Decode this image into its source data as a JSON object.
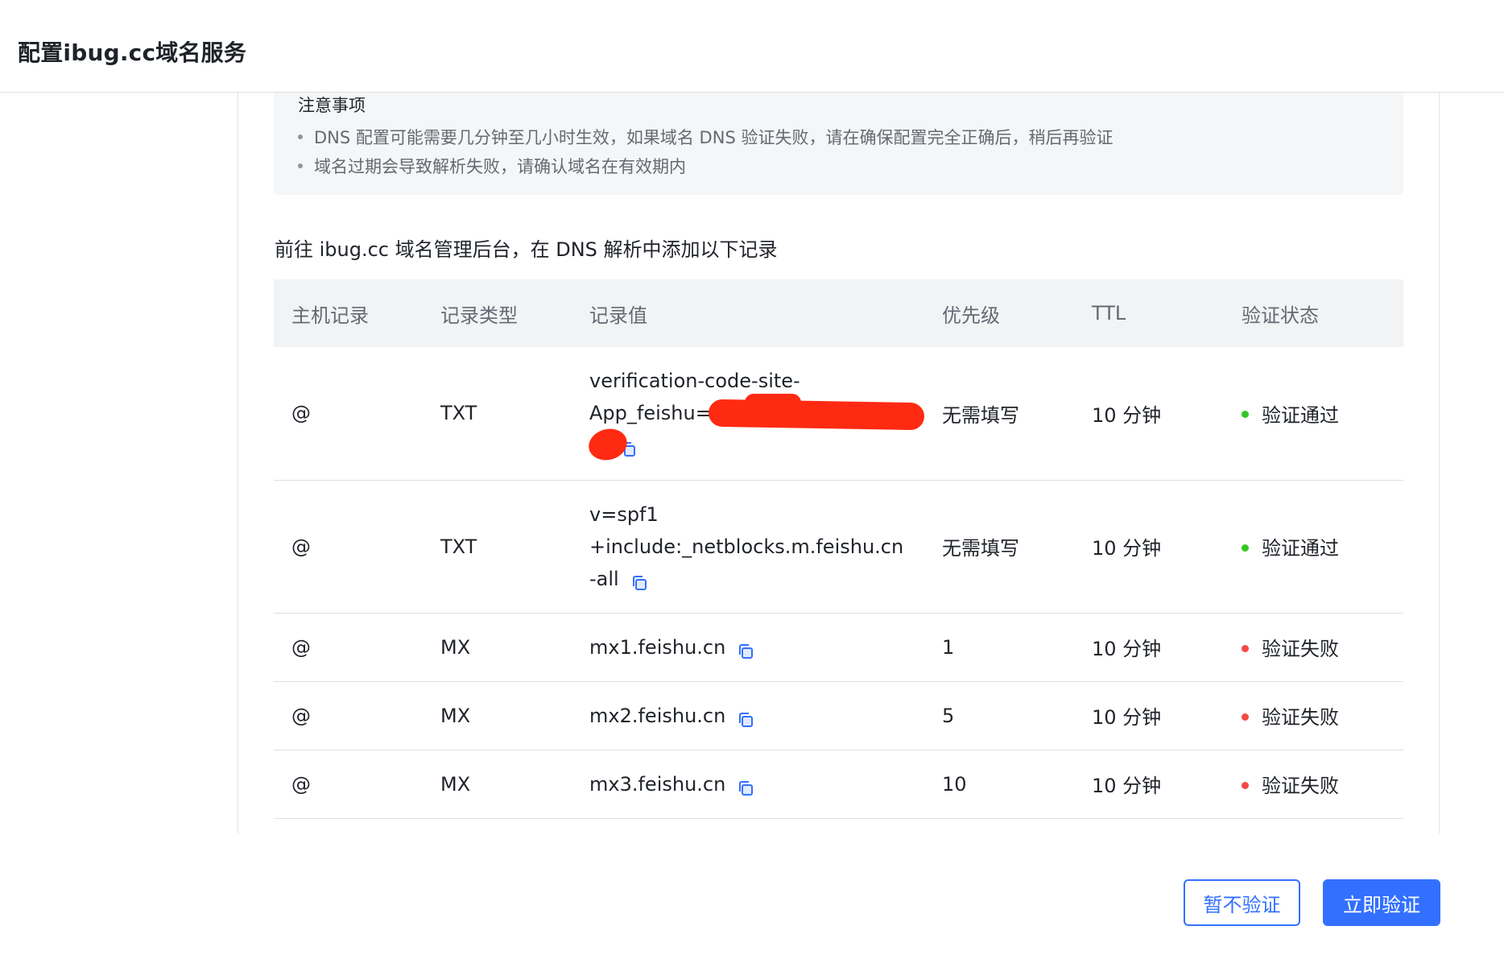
{
  "header": {
    "title": "配置ibug.cc域名服务"
  },
  "notice": {
    "title": "注意事项",
    "items": [
      "DNS 配置可能需要几分钟至几小时生效，如果域名 DNS 验证失败，请在确保配置完全正确后，稍后再验证",
      "域名过期会导致解析失败，请确认域名在有效期内"
    ]
  },
  "instruction": "前往 ibug.cc 域名管理后台，在 DNS 解析中添加以下记录",
  "table": {
    "columns": [
      "主机记录",
      "记录类型",
      "记录值",
      "优先级",
      "TTL",
      "验证状态"
    ],
    "rows": [
      {
        "host": "@",
        "type": "TXT",
        "value_lines": [
          "verification-code-site-",
          "App_feishu=",
          "..."
        ],
        "priority": "无需填写",
        "ttl": "10 分钟",
        "status": "验证通过"
      },
      {
        "host": "@",
        "type": "TXT",
        "value_lines": [
          "v=spf1",
          "+include:_netblocks.m.feishu.cn",
          "-all"
        ],
        "priority": "无需填写",
        "ttl": "10 分钟",
        "status": "验证通过"
      },
      {
        "host": "@",
        "type": "MX",
        "value_lines": [
          "mx1.feishu.cn"
        ],
        "priority": "1",
        "ttl": "10 分钟",
        "status": "验证失败"
      },
      {
        "host": "@",
        "type": "MX",
        "value_lines": [
          "mx2.feishu.cn"
        ],
        "priority": "5",
        "ttl": "10 分钟",
        "status": "验证失败"
      },
      {
        "host": "@",
        "type": "MX",
        "value_lines": [
          "mx3.feishu.cn"
        ],
        "priority": "10",
        "ttl": "10 分钟",
        "status": "验证失败"
      }
    ]
  },
  "status_colors": {
    "success": "#34c724",
    "failed": "#f54a45"
  },
  "accent_color": "#3370ff",
  "icons": {
    "copy": "copy-icon"
  },
  "buttons": {
    "skip_label": "暂不验证",
    "verify_label": "立即验证"
  }
}
